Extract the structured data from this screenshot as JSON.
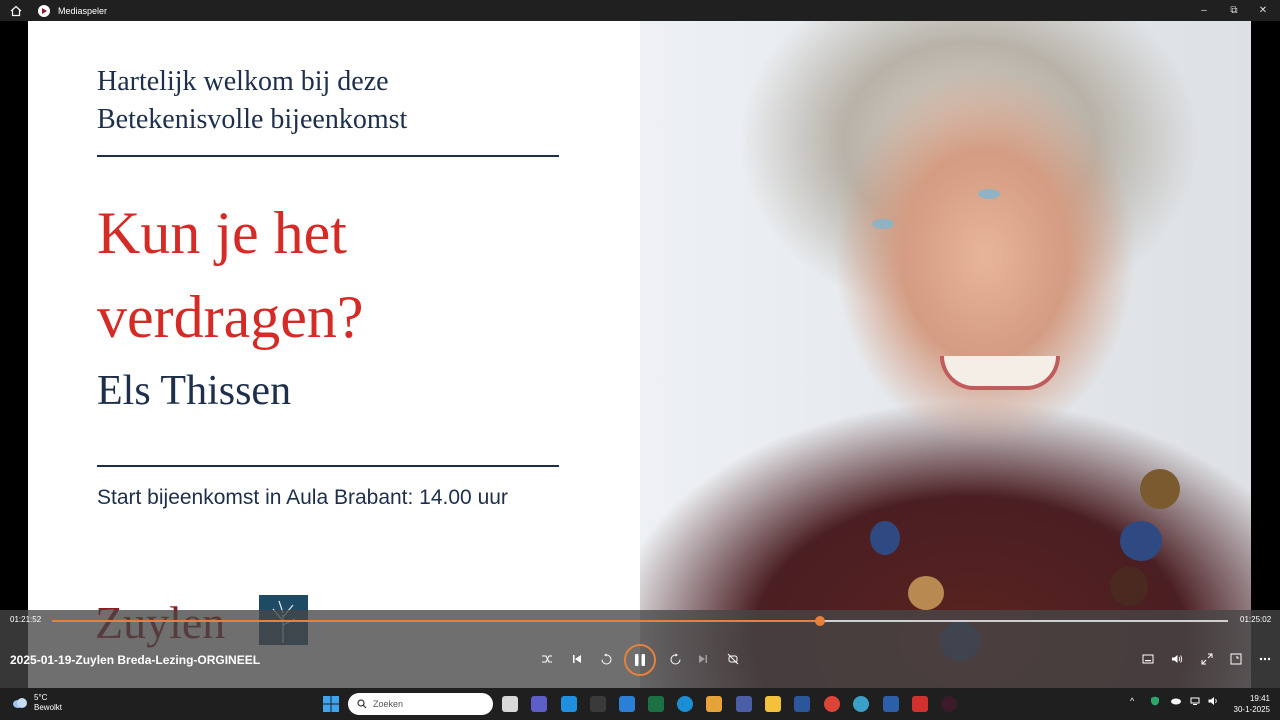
{
  "window": {
    "title": "Mediaspeler",
    "minimize": "–",
    "maximize": "⧉",
    "close": "✕"
  },
  "slide": {
    "welcome_line1": "Hartelijk welkom bij deze",
    "welcome_line2": "Betekenisvolle bijeenkomst",
    "title_line1": "Kun je het",
    "title_line2": "verdragen?",
    "speaker": "Els Thissen",
    "start": "Start bijeenkomst in Aula Brabant: 14.00 uur",
    "logo": "Zuylen"
  },
  "player": {
    "elapsed": "01:21:52",
    "total": "01:25:02",
    "progress": 0.653,
    "media_title": "2025-01-19-Zuylen Breda-Lezing-ORGINEEL",
    "accent": "#e8803a"
  },
  "taskbar": {
    "temperature": "5°C",
    "condition": "Bewolkt",
    "search_placeholder": "Zoeken",
    "time": "19:41",
    "date": "30-1-2025"
  }
}
